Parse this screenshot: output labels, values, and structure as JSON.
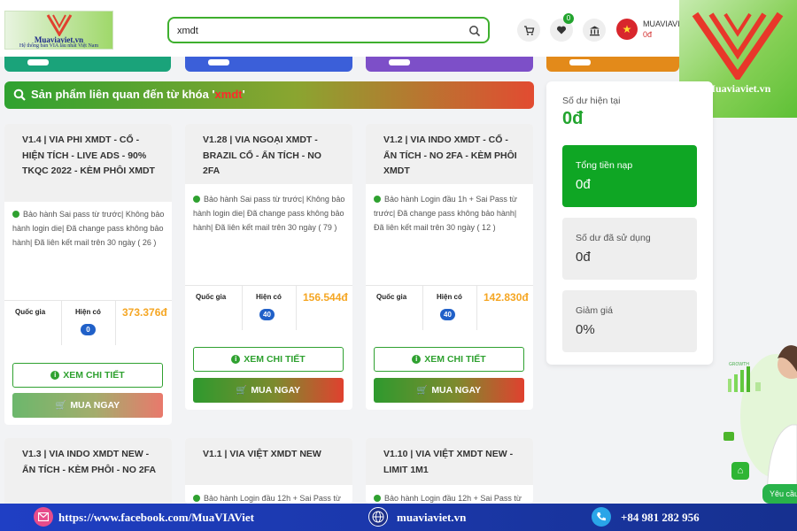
{
  "header": {
    "logo_brand": "Muaviaviet.vn",
    "logo_tagline": "Hệ thống bán VIA lâu nhất Việt Nam",
    "search_value": "xmdt",
    "wishlist_count": "0",
    "account_name": "MUAVIAVI",
    "account_balance": "0đ"
  },
  "overlay_logo_brand": "Muaviaviet.vn",
  "banner": {
    "prefix": "Sản phẩm liên quan đến từ khóa '",
    "keyword": "xmdt",
    "suffix": "'"
  },
  "labels": {
    "country": "Quốc gia",
    "stock": "Hiện có",
    "detail_button": "XEM CHI TIẾT",
    "buy_button": "MUA NGAY"
  },
  "products": [
    {
      "title": "V1.4 | VIA PHI XMDT - CỔ - HIỆN TÍCH - LIVE ADS - 90% TKQC 2022 - KÈM PHÔI XMDT",
      "desc": "Bảo hành Sai pass từ trước| Không bảo hành login die| Đã change pass không bảo hành| Đã liên kết mail trên 30 ngày ( 26 )",
      "stock": "0",
      "price": "373.376đ"
    },
    {
      "title": "V1.28 | VIA NGOẠI XMDT - BRAZIL CỔ - ẨN TÍCH - NO 2FA",
      "desc": "Bảo hành Sai pass từ trước| Không bảo hành login die| Đã change pass không bảo hành| Đã liên kết mail trên 30 ngày ( 79 )",
      "stock": "40",
      "price": "156.544đ"
    },
    {
      "title": "V1.2 | VIA INDO XMDT - CỔ - ẨN TÍCH - NO 2FA - KÈM PHÔI XMDT",
      "desc": "Bảo hành Login đầu 1h + Sai Pass từ trước| Đã change pass không bảo hành| Đã liên kết mail trên 30 ngày ( 12 )",
      "stock": "40",
      "price": "142.830đ"
    },
    {
      "title": "V1.3 | VIA INDO XMDT NEW - ẨN TÍCH - KÈM PHÔI - NO 2FA",
      "desc": ""
    },
    {
      "title": "V1.1 | VIA VIỆT XMDT NEW",
      "desc": "Bảo hành Login đầu 12h + Sai Pass từ"
    },
    {
      "title": "V1.10 | VIA VIỆT XMDT NEW - LIMIT 1M1",
      "desc": "Bảo hành Login đầu 12h + Sai Pass từ"
    }
  ],
  "balance": {
    "current_label": "Số dư hiện tại",
    "current_value": "0đ",
    "topup_label": "Tổng tiền nạp",
    "topup_value": "0đ",
    "used_label": "Số dư đã sử dụng",
    "used_value": "0đ",
    "discount_label": "Giảm giá",
    "discount_value": "0%"
  },
  "side_art": {
    "growth_label": "GROWTH"
  },
  "chat_bubble": "Yêu cầu",
  "footer": {
    "facebook": "https://www.facebook.com/MuaVIAViet",
    "website": "muaviaviet.vn",
    "phone": "+84 981 282 956"
  },
  "colors": {
    "accent_green": "#22a42e",
    "price_orange": "#f5a623",
    "footer_blue": "#1f3fc4",
    "stub_colors": [
      "#1aa37a",
      "#3b5fd9",
      "#7d4fc8",
      "#e38a1a"
    ]
  }
}
